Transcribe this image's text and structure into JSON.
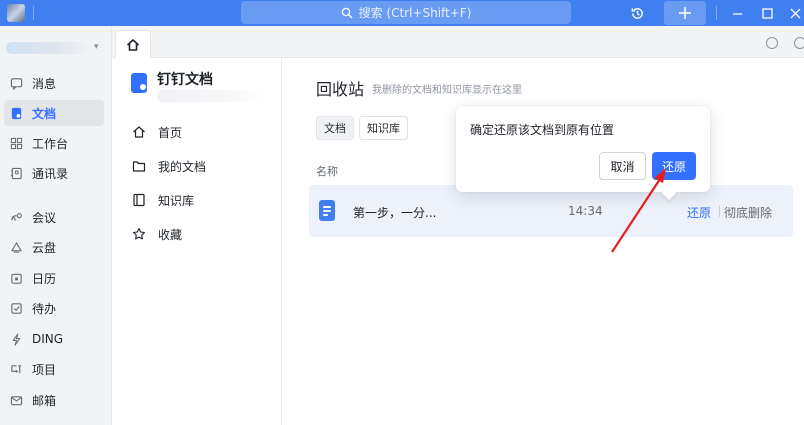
{
  "titlebar": {
    "search_placeholder": "搜索 (Ctrl+Shift+F)",
    "icons": [
      "app-logo",
      "search-icon",
      "history-icon",
      "plus-icon",
      "minimize-icon",
      "maximize-icon",
      "close-icon"
    ]
  },
  "sidebar": {
    "items": [
      {
        "label": "消息",
        "icon": "message-icon"
      },
      {
        "label": "文档",
        "icon": "document-icon",
        "active": true
      },
      {
        "label": "工作台",
        "icon": "workbench-icon"
      },
      {
        "label": "通讯录",
        "icon": "contacts-icon"
      },
      {
        "label": "会议",
        "icon": "meeting-icon"
      },
      {
        "label": "云盘",
        "icon": "cloud-drive-icon"
      },
      {
        "label": "日历",
        "icon": "calendar-icon"
      },
      {
        "label": "待办",
        "icon": "todo-icon"
      },
      {
        "label": "DING",
        "icon": "ding-icon"
      },
      {
        "label": "项目",
        "icon": "project-icon"
      },
      {
        "label": "邮箱",
        "icon": "mail-icon"
      }
    ]
  },
  "docnav": {
    "title": "钉钉文档",
    "items": [
      {
        "label": "首页",
        "icon": "home-icon"
      },
      {
        "label": "我的文档",
        "icon": "folder-icon"
      },
      {
        "label": "知识库",
        "icon": "book-icon"
      },
      {
        "label": "收藏",
        "icon": "star-icon"
      }
    ]
  },
  "main": {
    "title": "回收站",
    "description": "我删除的文档和知识库显示在这里",
    "filters": [
      "文档",
      "知识库"
    ],
    "column_name": "名称",
    "rows": [
      {
        "name": "第一步，一分...",
        "time": "14:34",
        "restore": "还原",
        "delete": "彻底删除"
      }
    ]
  },
  "popover": {
    "message": "确定还原该文档到原有位置",
    "cancel": "取消",
    "confirm": "还原"
  },
  "colors": {
    "titlebar": "#3f7ff0",
    "accent": "#3370ff",
    "annotation_arrow": "#e02020"
  }
}
